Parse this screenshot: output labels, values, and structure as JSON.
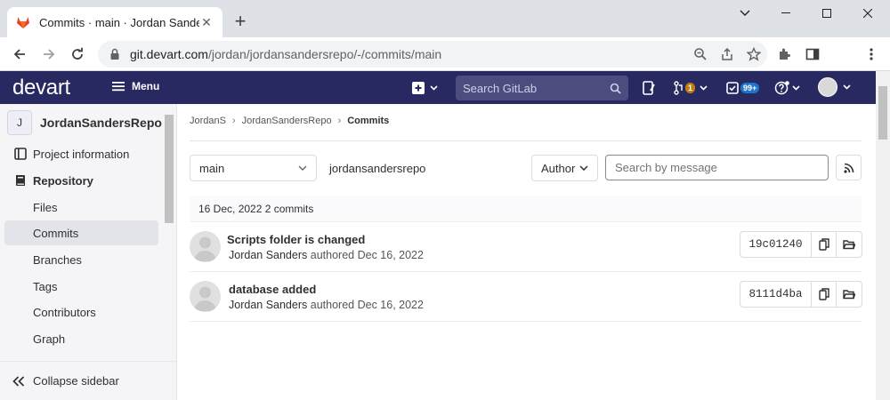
{
  "browser": {
    "tab_title": "Commits · main · Jordan Sanders",
    "url_host": "git.devart.com",
    "url_path": "/jordan/jordansandersrepo/-/commits/main"
  },
  "topnav": {
    "logo": "devart",
    "menu_label": "Menu",
    "search_placeholder": "Search GitLab",
    "mr_count": "1",
    "todo_count": "99+"
  },
  "sidebar": {
    "project_initial": "J",
    "project_name": "JordanSandersRepo",
    "items": [
      {
        "label": "Project information"
      },
      {
        "label": "Repository"
      },
      {
        "label": "Files"
      },
      {
        "label": "Commits"
      },
      {
        "label": "Branches"
      },
      {
        "label": "Tags"
      },
      {
        "label": "Contributors"
      },
      {
        "label": "Graph"
      }
    ],
    "collapse_label": "Collapse sidebar"
  },
  "breadcrumb": {
    "items": [
      "JordanS",
      "JordanSandersRepo",
      "Commits"
    ]
  },
  "filters": {
    "branch": "main",
    "repo": "jordansandersrepo",
    "author_label": "Author",
    "search_placeholder": "Search by message"
  },
  "commits": {
    "day_header": "16 Dec, 2022 2 commits",
    "rows": [
      {
        "title": "Scripts folder is changed",
        "author": "Jordan Sanders",
        "verb": "authored",
        "date": "Dec 16, 2022",
        "sha": "19c01240"
      },
      {
        "title": "database added",
        "author": "Jordan Sanders",
        "verb": "authored",
        "date": "Dec 16, 2022",
        "sha": "8111d4ba"
      }
    ]
  },
  "colors": {
    "nav_bg": "#292961",
    "search_bg": "#4c4c7e",
    "mr_badge": "#c17d10",
    "todo_badge": "#1f75cb"
  }
}
